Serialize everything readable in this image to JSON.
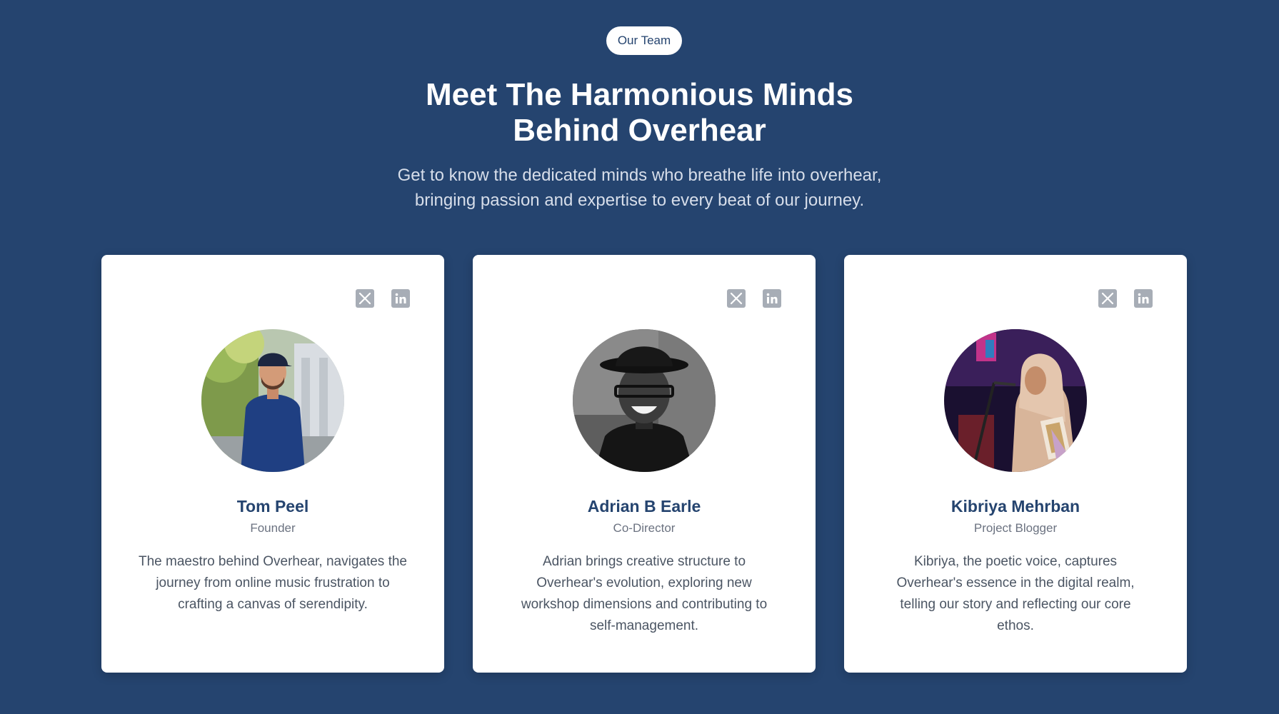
{
  "badge": "Our Team",
  "headline": {
    "line1": "Meet The Harmonious Minds",
    "line2": "Behind Overhear"
  },
  "subtitle": {
    "line1": "Get to know the dedicated minds who breathe life into overhear,",
    "line2": "bringing passion and expertise to every beat of our journey."
  },
  "colors": {
    "background": "#25446f",
    "card": "#ffffff",
    "name": "#25446f",
    "icon": "#a7adb6"
  },
  "team": [
    {
      "name": "Tom Peel",
      "role": "Founder",
      "bio": "The maestro behind Overhear, navigates the journey from online music frustration to crafting a canvas of serendipity.",
      "socials": [
        "x-icon",
        "linkedin-icon"
      ]
    },
    {
      "name": "Adrian B Earle",
      "role": "Co-Director",
      "bio": "Adrian brings creative structure to Overhear's evolution, exploring new workshop dimensions and contributing to self-management.",
      "socials": [
        "x-icon",
        "linkedin-icon"
      ]
    },
    {
      "name": "Kibriya Mehrban",
      "role": "Project Blogger",
      "bio": "Kibriya, the poetic voice, captures Overhear's essence in the digital realm, telling our story and reflecting our core ethos.",
      "socials": [
        "x-icon",
        "linkedin-icon"
      ]
    }
  ]
}
